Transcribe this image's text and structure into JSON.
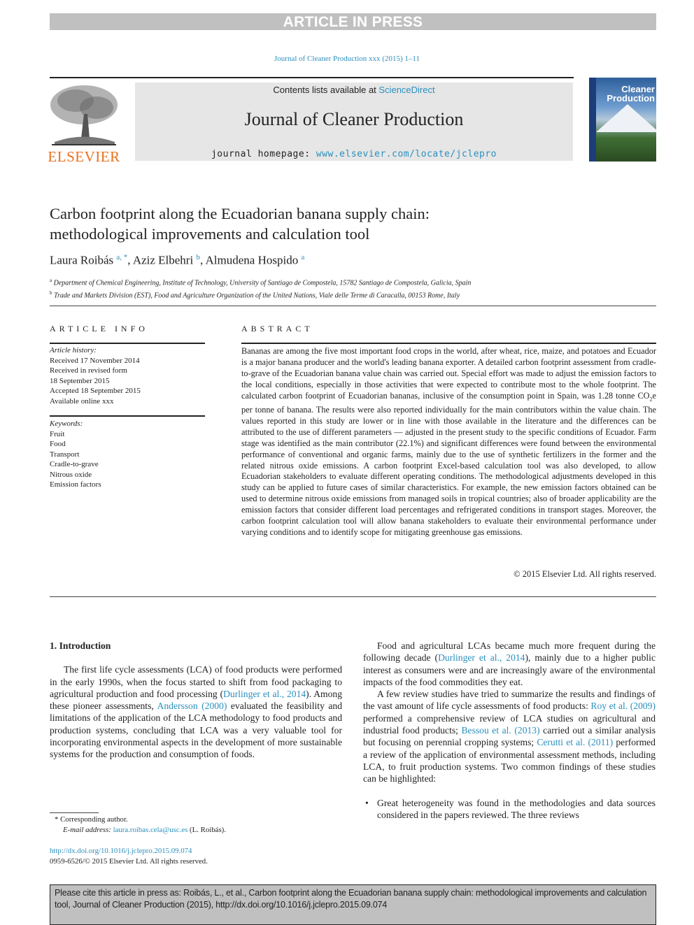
{
  "banner": {
    "text": "ARTICLE IN PRESS"
  },
  "running_head": "Journal of Cleaner Production xxx (2015) 1–11",
  "publisher": {
    "name": "ELSEVIER",
    "accent_color": "#e9711c"
  },
  "masthead": {
    "contents_prefix": "Contents lists available at ",
    "contents_link": "ScienceDirect",
    "journal_name": "Journal of Cleaner Production",
    "homepage_prefix": "journal homepage: ",
    "homepage_link": "www.elsevier.com/locate/jclepro"
  },
  "cover": {
    "title_line1": "Cleaner",
    "title_line2": "Production"
  },
  "article": {
    "title_line1": "Carbon footprint along the Ecuadorian banana supply chain:",
    "title_line2": "methodological improvements and calculation tool",
    "authors": [
      {
        "name": "Laura Roibás",
        "sup": "a, *"
      },
      {
        "name": "Aziz Elbehri",
        "sup": "b"
      },
      {
        "name": "Almudena Hospido",
        "sup": "a"
      }
    ],
    "affiliations": [
      {
        "sup": "a",
        "text": "Department of Chemical Engineering, Institute of Technology, University of Santiago de Compostela, 15782 Santiago de Compostela, Galicia, Spain"
      },
      {
        "sup": "b",
        "text": "Trade and Markets Division (EST), Food and Agriculture Organization of the United Nations, Viale delle Terme di Caracalla, 00153 Rome, Italy"
      }
    ]
  },
  "article_info": {
    "heading": "ARTICLE INFO",
    "history_label": "Article history:",
    "history": [
      "Received 17 November 2014",
      "Received in revised form",
      "18 September 2015",
      "Accepted 18 September 2015",
      "Available online xxx"
    ],
    "keywords_label": "Keywords:",
    "keywords": [
      "Fruit",
      "Food",
      "Transport",
      "Cradle-to-grave",
      "Nitrous oxide",
      "Emission factors"
    ]
  },
  "abstract": {
    "heading": "ABSTRACT",
    "text_before_co2": "Bananas are among the five most important food crops in the world, after wheat, rice, maize, and potatoes and Ecuador is a major banana producer and the world's leading banana exporter. A detailed carbon footprint assessment from cradle-to-grave of the Ecuadorian banana value chain was carried out. Special effort was made to adjust the emission factors to the local conditions, especially in those activities that were expected to contribute most to the whole footprint. The calculated carbon footprint of Ecuadorian bananas, inclusive of the consumption point in Spain, was 1.28 tonne CO",
    "co2_sub": "2",
    "text_after_co2": "e per tonne of banana. The results were also reported individually for the main contributors within the value chain. The values reported in this study are lower or in line with those available in the literature and the differences can be attributed to the use of different parameters — adjusted in the present study to the specific conditions of Ecuador. Farm stage was identified as the main contributor (22.1%) and significant differences were found between the environmental performance of conventional and organic farms, mainly due to the use of synthetic fertilizers in the former and the related nitrous oxide emissions. A carbon footprint Excel-based calculation tool was also developed, to allow Ecuadorian stakeholders to evaluate different operating conditions. The methodological adjustments developed in this study can be applied to future cases of similar characteristics. For example, the new emission factors obtained can be used to determine nitrous oxide emissions from managed soils in tropical countries; also of broader applicability are the emission factors that consider different load percentages and refrigerated conditions in transport stages. Moreover, the carbon footprint calculation tool will allow banana stakeholders to evaluate their environmental performance under varying conditions and to identify scope for mitigating greenhouse gas emissions.",
    "copyright": "© 2015 Elsevier Ltd. All rights reserved."
  },
  "body": {
    "section_heading": "1.  Introduction",
    "left_p1": {
      "t1": "The first life cycle assessments (LCA) of food products were performed in the early 1990s, when the focus started to shift from food packaging to agricultural production and food processing (",
      "l1": "Durlinger et al., 2014",
      "t2": "). Among these pioneer assessments, ",
      "l2": "Andersson (2000)",
      "t3": " evaluated the feasibility and limitations of the application of the LCA methodology to food products and production systems, concluding that LCA was a very valuable tool for incorporating environmental aspects in the development of more sustainable systems for the production and consumption of foods."
    },
    "right_p1": {
      "t1": "Food and agricultural LCAs became much more frequent during the following decade (",
      "l1": "Durlinger et al., 2014",
      "t2": "), mainly due to a higher public interest as consumers were and are increasingly aware of the environmental impacts of the food commodities they eat."
    },
    "right_p2": {
      "t1": "A few review studies have tried to summarize the results and findings of the vast amount of life cycle assessments of food products: ",
      "l1": "Roy et al. (2009)",
      "t2": " performed a comprehensive review of LCA studies on agricultural and industrial food products; ",
      "l2": "Bessou et al. (2013)",
      "t3": " carried out a similar analysis but focusing on perennial cropping systems; ",
      "l3": "Cerutti et al. (2011)",
      "t4": " performed a review of the application of environmental assessment methods, including LCA, to fruit production systems. Two common findings of these studies can be highlighted:"
    },
    "bullet1": "Great heterogeneity was found in the methodologies and data sources considered in the papers reviewed. The three reviews"
  },
  "footnotes": {
    "corresponding": "* Corresponding author.",
    "email_label": "E-mail address: ",
    "email": "laura.roibas.cela@usc.es",
    "email_suffix": " (L. Roibás).",
    "doi": "http://dx.doi.org/10.1016/j.jclepro.2015.09.074",
    "issn": "0959-6526/© 2015 Elsevier Ltd. All rights reserved."
  },
  "citation_box": {
    "text": "Please cite this article in press as: Roibás, L., et al., Carbon footprint along the Ecuadorian banana supply chain: methodological improvements and calculation tool, Journal of Cleaner Production (2015), http://dx.doi.org/10.1016/j.jclepro.2015.09.074"
  }
}
